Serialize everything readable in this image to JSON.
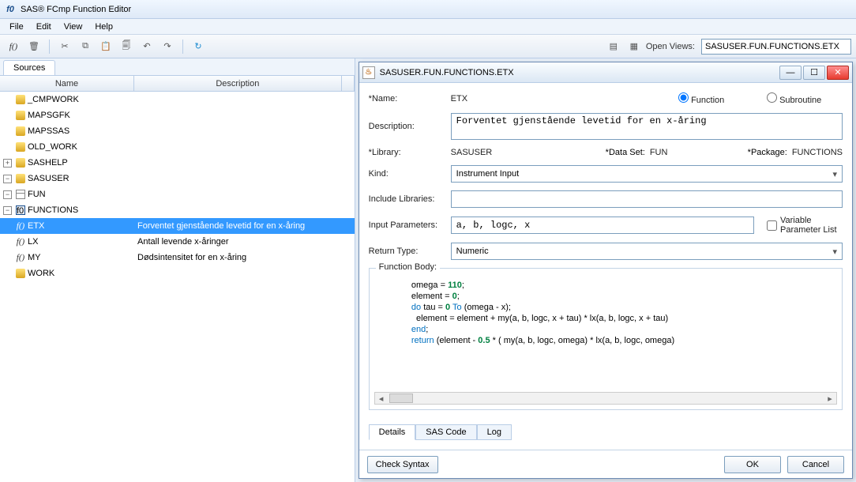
{
  "app": {
    "title": "SAS® FCmp Function Editor"
  },
  "menu": {
    "file": "File",
    "edit": "Edit",
    "view": "View",
    "help": "Help"
  },
  "toolbar": {
    "open_views_label": "Open Views:",
    "open_views_value": "SASUSER.FUN.FUNCTIONS.ETX"
  },
  "sources": {
    "tab_label": "Sources",
    "col_name": "Name",
    "col_desc": "Description",
    "tree": [
      {
        "name": "_CMPWORK",
        "type": "lib"
      },
      {
        "name": "MAPSGFK",
        "type": "lib"
      },
      {
        "name": "MAPSSAS",
        "type": "lib"
      },
      {
        "name": "OLD_WORK",
        "type": "lib"
      },
      {
        "name": "SASHELP",
        "type": "lib"
      },
      {
        "name": "SASUSER",
        "type": "lib"
      },
      {
        "name": "FUN",
        "type": "ds"
      },
      {
        "name": "FUNCTIONS",
        "type": "pkg"
      },
      {
        "name": "ETX",
        "type": "fn",
        "desc": "Forventet gjenstående levetid for en x-åring"
      },
      {
        "name": "LX",
        "type": "fn",
        "desc": "Antall levende x-åringer"
      },
      {
        "name": "MY",
        "type": "fn",
        "desc": "Dødsintensitet for en x-åring"
      },
      {
        "name": "WORK",
        "type": "lib"
      }
    ]
  },
  "editor": {
    "window_title": "SASUSER.FUN.FUNCTIONS.ETX",
    "name_label": "*Name:",
    "name_value": "ETX",
    "radio_function": "Function",
    "radio_subroutine": "Subroutine",
    "desc_label": "Description:",
    "desc_value": "Forventet gjenstående levetid for en x-åring",
    "library_label": "*Library:",
    "library_value": "SASUSER",
    "dataset_label": "*Data Set:",
    "dataset_value": "FUN",
    "package_label": "*Package:",
    "package_value": "FUNCTIONS",
    "kind_label": "Kind:",
    "kind_value": "Instrument Input",
    "include_label": "Include Libraries:",
    "include_value": "",
    "params_label": "Input Parameters:",
    "params_value": "a, b, logc, x",
    "varparam_label": "Variable Parameter List",
    "return_label": "Return Type:",
    "return_value": "Numeric",
    "body_label": "Function Body:",
    "code_lines": {
      "l1a": "omega = ",
      "l1b": "110",
      "l1c": ";",
      "l2a": "element = ",
      "l2b": "0",
      "l2c": ";",
      "l3a": "do",
      "l3b": " tau = ",
      "l3c": "0",
      "l3d": " To",
      "l3e": " (omega - x);",
      "l4": "  element = element + my(a, b, logc, x + tau) * lx(a, b, logc, x + tau)",
      "l5": "end",
      "l5b": ";",
      "l6a": "return",
      "l6b": " (element - ",
      "l6c": "0.5",
      "l6d": " * ( my(a, b, logc, omega) * lx(a, b, logc, omega) "
    },
    "tabs": {
      "details": "Details",
      "sas": "SAS Code",
      "log": "Log"
    },
    "buttons": {
      "check": "Check Syntax",
      "ok": "OK",
      "cancel": "Cancel"
    }
  }
}
